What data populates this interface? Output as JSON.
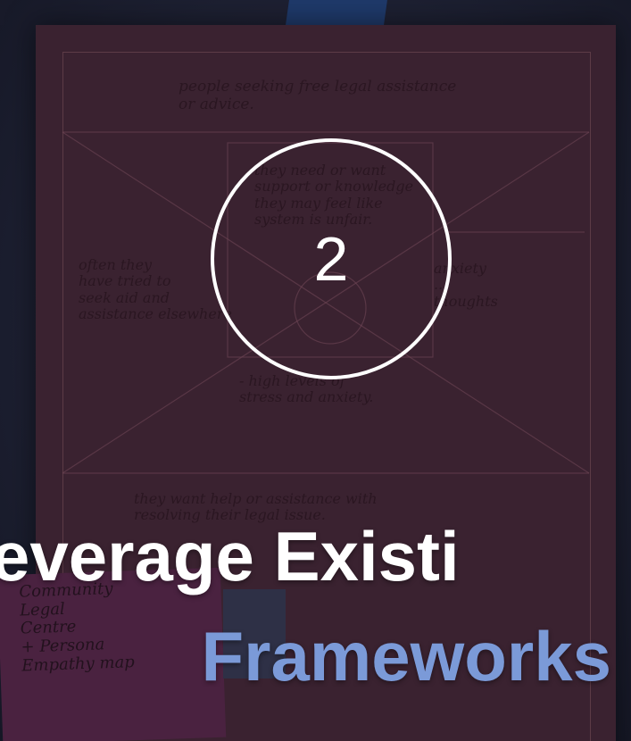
{
  "slide": {
    "number": "2",
    "title_line1": "everage Existi",
    "title_line2": "Frameworks"
  },
  "background_sketch": {
    "top_note": "people seeking free legal assistance\nor advice.",
    "center_note": "they need or want\nsupport or knowledge\nthey may feel like\nsystem is unfair.",
    "left_note": "often they\nhave tried to\nseek aid and\nassistance elsewhere",
    "right_note": "anxiety\n...\nthoughts",
    "lower_note": "- high levels of\nstress and anxiety.",
    "bottom_note": "they want help or assistance with\nresolving their legal issue.",
    "sticky_note": "Community\nLegal\nCentre\n+ Persona\nEmpathy map"
  },
  "colors": {
    "title_primary": "#ffffff",
    "title_accent": "#7b9ad8",
    "ring": "#ffffff"
  }
}
